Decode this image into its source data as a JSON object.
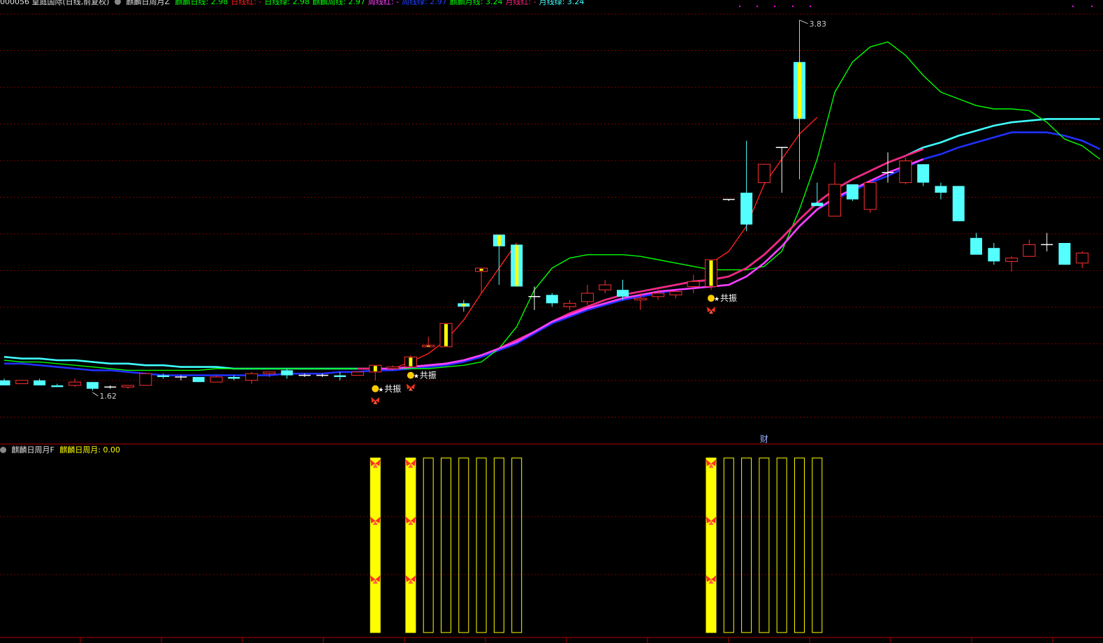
{
  "main_header": {
    "symbol_text": "000056 皇庭国际(日线,前复权)",
    "indicator_name": "麒麟日周月Z",
    "items": [
      {
        "text": "麒麟日线: 2.98",
        "color": "#00ff00"
      },
      {
        "text": "日线红: -",
        "color": "#ff2020"
      },
      {
        "text": "日线绿: 2.98",
        "color": "#00ff00"
      },
      {
        "text": "麒麟周线: 2.97",
        "color": "#00ff00"
      },
      {
        "text": "周线红: -",
        "color": "#ff40ff"
      },
      {
        "text": "周线绿: 2.97",
        "color": "#2040ff"
      },
      {
        "text": "麒麟月线: 3.24",
        "color": "#00ff00"
      },
      {
        "text": "月线红: -",
        "color": "#ff2080"
      },
      {
        "text": "月线绿: 3.24",
        "color": "#40ffff"
      }
    ]
  },
  "sub_header": {
    "indicator_name": "麒麟日周月F",
    "value_text": "麒麟日周月: 0.00"
  },
  "annotations": {
    "high_label": "3.83",
    "low_label": "1.62",
    "resonance_label": "共振",
    "finance_marker": "财"
  },
  "colors": {
    "up": "#ff3030",
    "down": "#54ffff",
    "doji": "#ffffff",
    "signal": "#ffff00",
    "daily_red": "#ff2020",
    "daily_green": "#00ff00",
    "weekly_red": "#ff40ff",
    "weekly_blue": "#2030ff",
    "monthly_red": "#ff2080",
    "monthly_cyan": "#40ffff",
    "grid": "#7a0000"
  },
  "chart_data": [
    {
      "type": "candlestick",
      "title": "皇庭国际 日线 前复权",
      "ylim": [
        1.45,
        3.9
      ],
      "high_marker": 3.83,
      "low_marker": 1.62,
      "candles": [
        {
          "o": 1.68,
          "h": 1.69,
          "l": 1.65,
          "c": 1.65
        },
        {
          "o": 1.66,
          "h": 1.68,
          "l": 1.66,
          "c": 1.68
        },
        {
          "o": 1.68,
          "h": 1.69,
          "l": 1.65,
          "c": 1.65
        },
        {
          "o": 1.65,
          "h": 1.66,
          "l": 1.64,
          "c": 1.64
        },
        {
          "o": 1.65,
          "h": 1.69,
          "l": 1.64,
          "c": 1.67
        },
        {
          "o": 1.67,
          "h": 1.67,
          "l": 1.62,
          "c": 1.63
        },
        {
          "o": 1.64,
          "h": 1.65,
          "l": 1.63,
          "c": 1.64
        },
        {
          "o": 1.64,
          "h": 1.65,
          "l": 1.63,
          "c": 1.65
        },
        {
          "o": 1.65,
          "h": 1.72,
          "l": 1.65,
          "c": 1.72
        },
        {
          "o": 1.71,
          "h": 1.72,
          "l": 1.69,
          "c": 1.7
        },
        {
          "o": 1.7,
          "h": 1.71,
          "l": 1.68,
          "c": 1.7
        },
        {
          "o": 1.7,
          "h": 1.7,
          "l": 1.67,
          "c": 1.67
        },
        {
          "o": 1.67,
          "h": 1.71,
          "l": 1.67,
          "c": 1.7
        },
        {
          "o": 1.7,
          "h": 1.71,
          "l": 1.68,
          "c": 1.69
        },
        {
          "o": 1.68,
          "h": 1.73,
          "l": 1.66,
          "c": 1.72
        },
        {
          "o": 1.72,
          "h": 1.73,
          "l": 1.7,
          "c": 1.73
        },
        {
          "o": 1.74,
          "h": 1.75,
          "l": 1.69,
          "c": 1.71
        },
        {
          "o": 1.71,
          "h": 1.72,
          "l": 1.7,
          "c": 1.71
        },
        {
          "o": 1.71,
          "h": 1.72,
          "l": 1.7,
          "c": 1.71
        },
        {
          "o": 1.71,
          "h": 1.73,
          "l": 1.68,
          "c": 1.7
        },
        {
          "o": 1.71,
          "h": 1.73,
          "l": 1.71,
          "c": 1.73
        },
        {
          "o": 1.73,
          "h": 1.75,
          "l": 1.68,
          "c": 1.77,
          "sig": true
        },
        {
          "o": 1.75,
          "h": 1.77,
          "l": 1.74,
          "c": 1.76
        },
        {
          "o": 1.76,
          "h": 1.83,
          "l": 1.76,
          "c": 1.82,
          "sig": true
        },
        {
          "o": 1.88,
          "h": 1.94,
          "l": 1.88,
          "c": 1.89,
          "sig": true
        },
        {
          "o": 1.88,
          "h": 2.02,
          "l": 1.88,
          "c": 2.02,
          "sig": true
        },
        {
          "o": 2.14,
          "h": 2.16,
          "l": 2.09,
          "c": 2.12,
          "sig": true
        },
        {
          "o": 2.33,
          "h": 2.35,
          "l": 2.2,
          "c": 2.35,
          "sig": true
        },
        {
          "o": 2.55,
          "h": 2.55,
          "l": 2.25,
          "c": 2.48,
          "sig": true
        },
        {
          "o": 2.49,
          "h": 2.49,
          "l": 2.24,
          "c": 2.24,
          "sig": true
        },
        {
          "o": 2.18,
          "h": 2.24,
          "l": 2.1,
          "c": 2.18
        },
        {
          "o": 2.19,
          "h": 2.2,
          "l": 2.12,
          "c": 2.14
        },
        {
          "o": 2.12,
          "h": 2.16,
          "l": 2.1,
          "c": 2.14
        },
        {
          "o": 2.15,
          "h": 2.25,
          "l": 2.13,
          "c": 2.2
        },
        {
          "o": 2.22,
          "h": 2.28,
          "l": 2.2,
          "c": 2.25
        },
        {
          "o": 2.22,
          "h": 2.28,
          "l": 2.16,
          "c": 2.18
        },
        {
          "o": 2.16,
          "h": 2.2,
          "l": 2.1,
          "c": 2.17
        },
        {
          "o": 2.18,
          "h": 2.22,
          "l": 2.16,
          "c": 2.2
        },
        {
          "o": 2.19,
          "h": 2.22,
          "l": 2.17,
          "c": 2.21
        },
        {
          "o": 2.24,
          "h": 2.31,
          "l": 2.2,
          "c": 2.27
        },
        {
          "o": 2.24,
          "h": 2.4,
          "l": 2.22,
          "c": 2.4,
          "sig": true
        },
        {
          "o": 2.76,
          "h": 2.76,
          "l": 2.75,
          "c": 2.76
        },
        {
          "o": 2.8,
          "h": 3.11,
          "l": 2.57,
          "c": 2.61
        },
        {
          "o": 2.86,
          "h": 2.97,
          "l": 2.86,
          "c": 2.97
        },
        {
          "o": 3.07,
          "h": 3.07,
          "l": 2.8,
          "c": 3.07
        },
        {
          "o": 3.58,
          "h": 3.83,
          "l": 2.88,
          "c": 3.24,
          "sig": true
        },
        {
          "o": 2.74,
          "h": 2.86,
          "l": 2.73,
          "c": 2.72
        },
        {
          "o": 2.66,
          "h": 2.98,
          "l": 2.66,
          "c": 2.85
        },
        {
          "o": 2.85,
          "h": 2.85,
          "l": 2.75,
          "c": 2.76
        },
        {
          "o": 2.7,
          "h": 2.88,
          "l": 2.68,
          "c": 2.86
        },
        {
          "o": 2.92,
          "h": 3.04,
          "l": 2.86,
          "c": 2.92
        },
        {
          "o": 2.86,
          "h": 3.01,
          "l": 2.85,
          "c": 2.99
        },
        {
          "o": 2.97,
          "h": 2.97,
          "l": 2.84,
          "c": 2.86
        },
        {
          "o": 2.84,
          "h": 2.86,
          "l": 2.76,
          "c": 2.8
        },
        {
          "o": 2.84,
          "h": 2.84,
          "l": 2.63,
          "c": 2.63
        },
        {
          "o": 2.53,
          "h": 2.56,
          "l": 2.43,
          "c": 2.43
        },
        {
          "o": 2.47,
          "h": 2.5,
          "l": 2.37,
          "c": 2.39
        },
        {
          "o": 2.39,
          "h": 2.42,
          "l": 2.33,
          "c": 2.41
        },
        {
          "o": 2.42,
          "h": 2.52,
          "l": 2.42,
          "c": 2.49
        },
        {
          "o": 2.49,
          "h": 2.56,
          "l": 2.45,
          "c": 2.49
        },
        {
          "o": 2.5,
          "h": 2.5,
          "l": 2.37,
          "c": 2.37
        },
        {
          "o": 2.38,
          "h": 2.45,
          "l": 2.35,
          "c": 2.44
        }
      ],
      "lines": [
        {
          "name": "麒麟日线",
          "color": "#00ff00",
          "values": [
            1.8,
            1.79,
            1.79,
            1.78,
            1.77,
            1.76,
            1.75,
            1.74,
            1.74,
            1.74,
            1.74,
            1.74,
            1.75,
            1.75,
            1.75,
            1.75,
            1.75,
            1.75,
            1.75,
            1.75,
            1.75,
            1.75,
            1.75,
            1.75,
            1.75,
            1.76,
            1.77,
            1.79,
            1.87,
            2.0,
            2.22,
            2.35,
            2.41,
            2.43,
            2.43,
            2.43,
            2.42,
            2.4,
            2.38,
            2.36,
            2.34,
            2.34,
            2.34,
            2.36,
            2.45,
            2.7,
            3.0,
            3.4,
            3.58,
            3.67,
            3.7,
            3.62,
            3.5,
            3.4,
            3.36,
            3.32,
            3.3,
            3.3,
            3.29,
            3.22,
            3.12,
            3.08,
            3.0
          ]
        },
        {
          "name": "日线红",
          "color": "#ff2020",
          "values": [
            null,
            null,
            null,
            null,
            null,
            null,
            null,
            null,
            null,
            null,
            null,
            null,
            null,
            null,
            null,
            null,
            null,
            null,
            null,
            null,
            null,
            null,
            1.75,
            1.79,
            1.84,
            1.92,
            2.04,
            2.2,
            2.35,
            2.5,
            null,
            null,
            null,
            null,
            null,
            null,
            null,
            null,
            null,
            null,
            2.38,
            2.45,
            2.6,
            2.85,
            3.0,
            3.15,
            3.25,
            null,
            null,
            null,
            null,
            null,
            null,
            null,
            null,
            null,
            null,
            null,
            null,
            null,
            null,
            null,
            null
          ]
        },
        {
          "name": "麒麟周线",
          "color": "#2030ff",
          "values": [
            1.78,
            1.78,
            1.77,
            1.76,
            1.75,
            1.74,
            1.74,
            1.73,
            1.72,
            1.71,
            1.71,
            1.71,
            1.71,
            1.71,
            1.71,
            1.71,
            1.72,
            1.72,
            1.72,
            1.73,
            1.73,
            1.74,
            1.74,
            1.75,
            1.76,
            1.77,
            1.79,
            1.82,
            1.86,
            1.9,
            1.96,
            2.02,
            2.06,
            2.1,
            2.13,
            2.16,
            2.18,
            2.2,
            2.22,
            2.23,
            2.24,
            2.25,
            2.3,
            2.38,
            2.48,
            2.6,
            2.7,
            2.76,
            2.81,
            2.86,
            2.9,
            2.95,
            3.0,
            3.03,
            3.07,
            3.1,
            3.13,
            3.16,
            3.16,
            3.16,
            3.14,
            3.11,
            3.06
          ]
        },
        {
          "name": "周线红",
          "color": "#ff40ff",
          "values": [
            null,
            null,
            null,
            null,
            null,
            null,
            null,
            null,
            null,
            null,
            null,
            null,
            null,
            null,
            null,
            null,
            null,
            null,
            null,
            null,
            null,
            1.75,
            1.75,
            1.76,
            1.77,
            1.78,
            1.8,
            1.83,
            1.87,
            1.91,
            1.97,
            2.03,
            2.07,
            2.11,
            2.14,
            2.17,
            2.19,
            2.21,
            2.22,
            2.23,
            2.24,
            2.25,
            2.3,
            2.38,
            2.48,
            2.6,
            2.7,
            2.77,
            2.82,
            2.87,
            2.92,
            2.96,
            3.0,
            null,
            null,
            null,
            null,
            null,
            null,
            null,
            null,
            null,
            null
          ]
        },
        {
          "name": "麒麟月线",
          "color": "#40ffff",
          "values": [
            1.82,
            1.81,
            1.81,
            1.8,
            1.8,
            1.79,
            1.78,
            1.78,
            1.77,
            1.77,
            1.76,
            1.76,
            1.76,
            1.75,
            1.75,
            1.75,
            1.75,
            1.75,
            1.75,
            1.75,
            1.75,
            1.75,
            1.75,
            1.76,
            1.77,
            1.78,
            1.8,
            1.83,
            1.87,
            1.92,
            1.97,
            2.03,
            2.08,
            2.12,
            2.16,
            2.19,
            2.21,
            2.23,
            2.25,
            2.27,
            2.28,
            2.3,
            2.35,
            2.43,
            2.53,
            2.64,
            2.74,
            2.82,
            2.88,
            2.93,
            2.98,
            3.02,
            3.07,
            3.1,
            3.14,
            3.17,
            3.2,
            3.22,
            3.23,
            3.24,
            3.24,
            3.24,
            3.24
          ]
        },
        {
          "name": "月线红",
          "color": "#ff2080",
          "values": [
            null,
            null,
            null,
            null,
            null,
            null,
            null,
            null,
            null,
            null,
            null,
            null,
            null,
            null,
            null,
            null,
            null,
            null,
            null,
            null,
            1.75,
            1.75,
            1.75,
            1.76,
            1.77,
            1.78,
            1.8,
            1.83,
            1.87,
            1.92,
            1.97,
            2.03,
            2.08,
            2.12,
            2.16,
            2.19,
            2.21,
            2.23,
            2.25,
            2.27,
            2.28,
            2.3,
            2.35,
            2.43,
            2.53,
            2.64,
            2.74,
            2.82,
            2.88,
            2.93,
            2.98,
            3.02,
            3.06,
            null,
            null,
            null,
            null,
            null,
            null,
            null,
            null,
            null,
            null
          ]
        }
      ],
      "resonance_at": [
        21,
        23,
        40
      ],
      "finance_at": 43
    },
    {
      "type": "bar",
      "title": "麒麟日周月F",
      "ylim": [
        0,
        1
      ],
      "values": [
        0,
        0,
        0,
        0,
        0,
        0,
        0,
        0,
        0,
        0,
        0,
        0,
        0,
        0,
        0,
        0,
        0,
        0,
        0,
        0,
        0,
        1,
        0,
        1,
        1,
        1,
        1,
        1,
        1,
        1,
        0,
        0,
        0,
        0,
        0,
        0,
        0,
        0,
        0,
        0,
        1,
        1,
        1,
        1,
        1,
        1,
        1,
        0,
        0,
        0,
        0,
        0,
        0,
        0,
        0,
        0,
        0,
        0,
        0,
        0,
        0,
        0,
        0
      ],
      "filled": [
        21,
        23,
        40
      ],
      "butterflies_at": [
        21,
        23,
        40
      ]
    }
  ]
}
